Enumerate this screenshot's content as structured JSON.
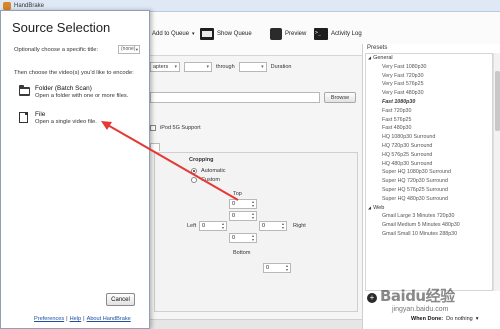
{
  "window": {
    "title": "HandBrake"
  },
  "toolbar": {
    "add_to_queue": "Add to Queue",
    "show_queue": "Show Queue",
    "preview": "Preview",
    "activity_log": "Activity Log"
  },
  "source_panel": {
    "range_type": "apters",
    "through_label": "through",
    "duration_label": "Duration",
    "browse_label": "Browse",
    "ipod_label": "iPod 5G Support"
  },
  "picture": {
    "cropping_label": "Cropping",
    "automatic_label": "Automatic",
    "custom_label": "Custom",
    "top_label": "Top",
    "left_label": "Left",
    "right_label": "Right",
    "bottom_label": "Bottom",
    "top_value": "0",
    "left_value": "0",
    "right_value": "0",
    "bottom_value": "0",
    "top_value2": "0",
    "bottom_value2": "0"
  },
  "presets": {
    "header": "Presets",
    "groups": [
      {
        "name": "General",
        "items": [
          "Very Fast 1080p30",
          "Very Fast 720p30",
          "Very Fast 576p25",
          "Very Fast 480p30",
          "Fast 1080p30",
          "Fast 720p30",
          "Fast 576p25",
          "Fast 480p30",
          "HQ 1080p30 Surround",
          "HQ 720p30 Surround",
          "HQ 576p25 Surround",
          "HQ 480p30 Surround",
          "Super HQ 1080p30 Surround",
          "Super HQ 720p30 Surround",
          "Super HQ 576p25 Surround",
          "Super HQ 480p30 Surround"
        ]
      },
      {
        "name": "Web",
        "items": [
          "Gmail Large 3 Minutes 720p30",
          "Gmail Medium 5 Minutes 480p30",
          "Gmail Small 10 Minutes 288p30"
        ]
      }
    ],
    "default_item": "Fast 1080p30"
  },
  "when_done": {
    "label": "When Done:",
    "value": "Do nothing"
  },
  "dialog": {
    "title": "Source Selection",
    "optional_title_label": "Optionally choose a specific title:",
    "optional_title_value": "(none)",
    "choose_label": "Then choose the video(s) you'd like to encode:",
    "folder_label": "Folder (Batch Scan)",
    "folder_desc": "Open a folder with one or more files.",
    "file_label": "File",
    "file_desc": "Open a single video file.",
    "cancel_label": "Cancel",
    "footer": {
      "preferences": "Preferences",
      "sep1": "|",
      "help": "Help",
      "sep2": "|",
      "about": "About HandBrake"
    }
  },
  "watermark": {
    "text": "Baidu经验",
    "sub": "jingyan.baidu.com"
  },
  "colors": {
    "arrow": "#e53935",
    "link": "#1d4fa3"
  }
}
